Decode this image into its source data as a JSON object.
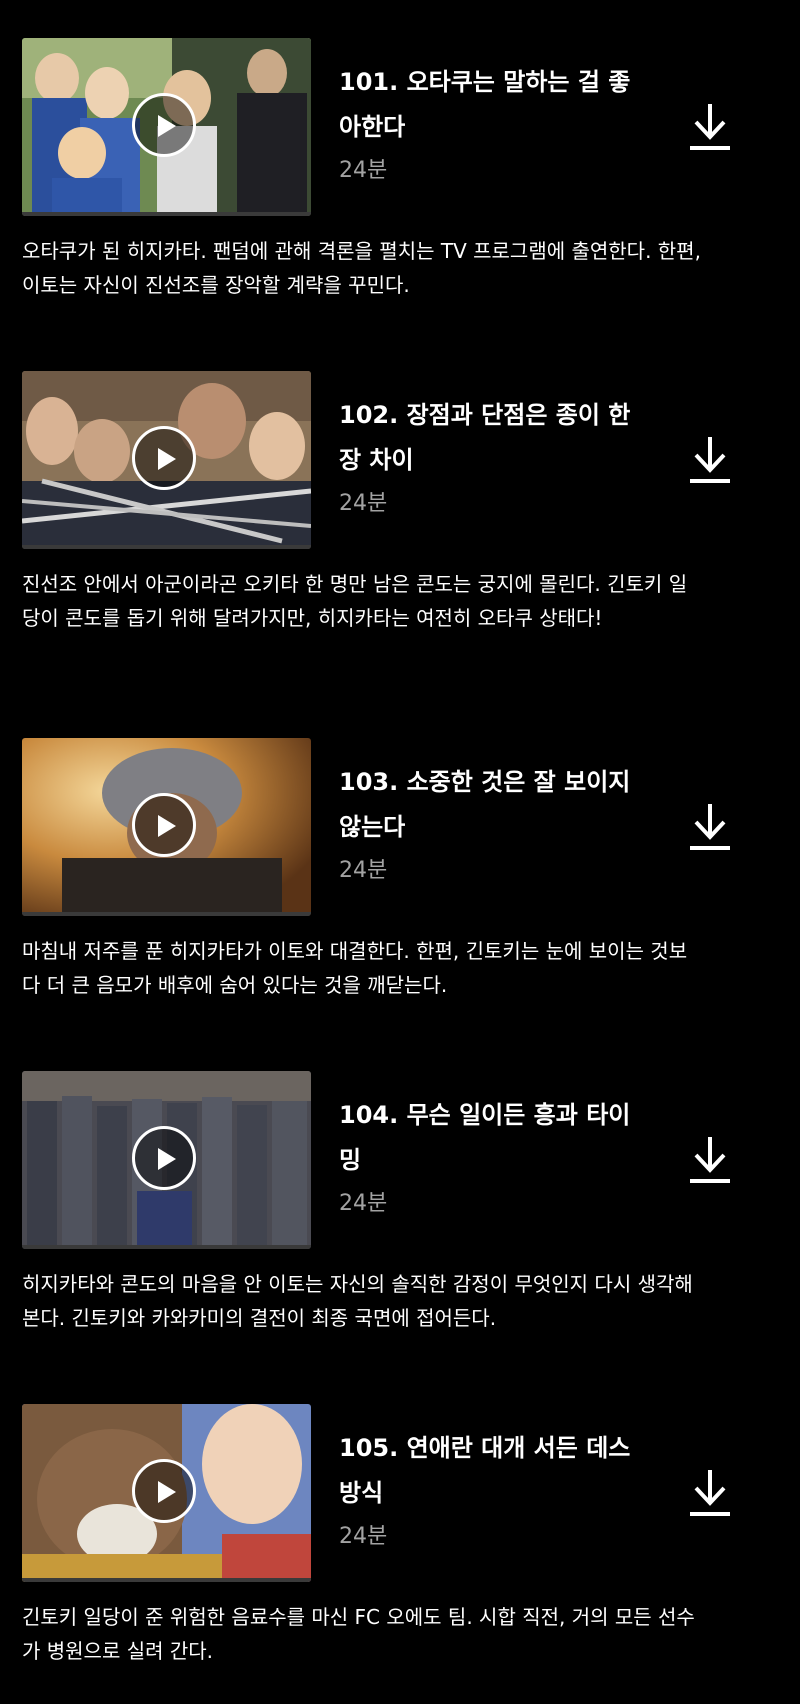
{
  "episodes": [
    {
      "title": "101. 오타쿠는 말하는 걸 좋아한다",
      "duration": "24분",
      "description": "오타쿠가 된 히지카타. 팬덤에 관해 격론을 펼치는 TV 프로그램에 출연한다. 한편, 이토는 자신이 진선조를 장악할 계략을 꾸민다."
    },
    {
      "title": "102. 장점과 단점은 종이 한 장 차이",
      "duration": "24분",
      "description": "진선조 안에서 아군이라곤 오키타 한 명만 남은 콘도는 궁지에 몰린다. 긴토키 일당이 콘도를 돕기 위해 달려가지만, 히지카타는 여전히 오타쿠 상태다!"
    },
    {
      "title": "103. 소중한 것은 잘 보이지 않는다",
      "duration": "24분",
      "description": "마침내 저주를 푼 히지카타가 이토와 대결한다. 한편, 긴토키는 눈에 보이는 것보다 더 큰 음모가 배후에 숨어 있다는 것을 깨닫는다."
    },
    {
      "title": "104. 무슨 일이든 흥과 타이밍",
      "duration": "24분",
      "description": "히지카타와 콘도의 마음을 안 이토는 자신의 솔직한 감정이 무엇인지 다시 생각해 본다. 긴토키와 카와카미의 결전이 최종 국면에 접어든다."
    },
    {
      "title": "105. 연애란 대개 서든 데스 방식",
      "duration": "24분",
      "description": "긴토키 일당이 준 위험한 음료수를 마신 FC 오에도 팀. 시합 직전, 거의 모든 선수가 병원으로 실려 간다."
    }
  ],
  "icons": {
    "play": "play-icon",
    "download": "download-icon"
  },
  "colors": {
    "background": "#000000",
    "text_primary": "#ffffff",
    "text_secondary": "#a3a3a3"
  }
}
